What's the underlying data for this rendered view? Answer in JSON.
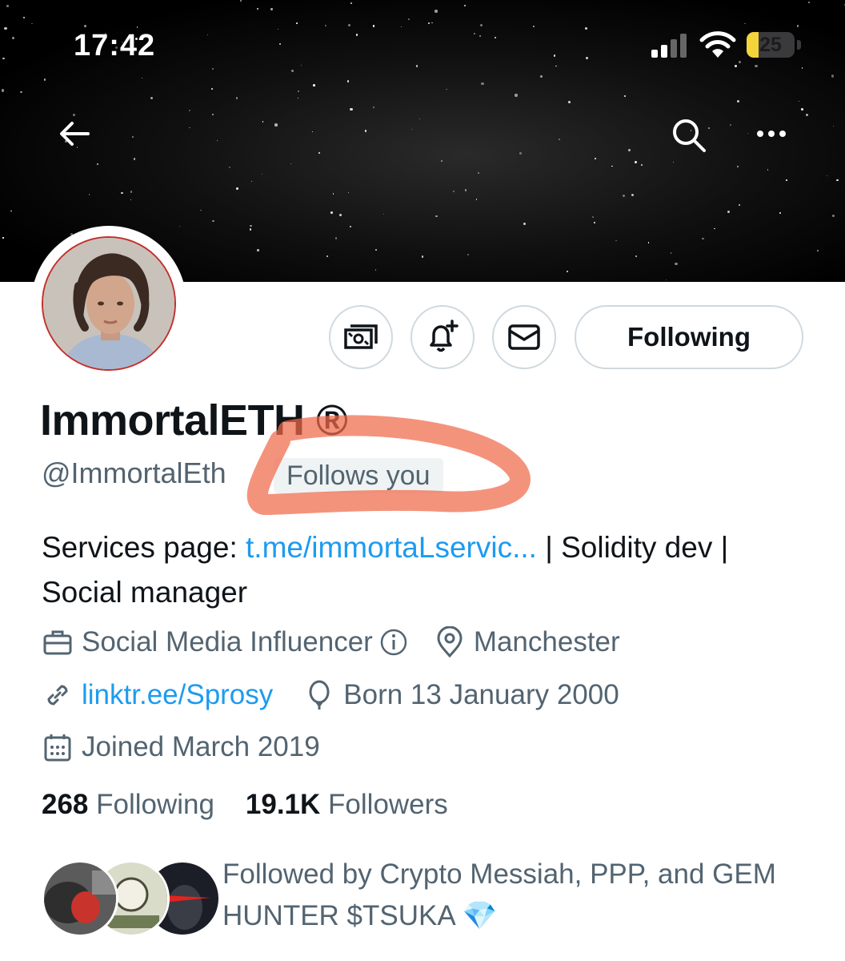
{
  "status_bar": {
    "time": "17:42",
    "battery": "25"
  },
  "profile": {
    "display_name": "ImmortalETH ®",
    "handle": "@ImmortalEth",
    "follows_you": "Follows you",
    "following_button": "Following",
    "bio": {
      "prefix": "Services page: ",
      "link": "t.me/immortaLservic...",
      "suffix": " | Solidity dev | Social manager"
    },
    "category": "Social Media Influencer",
    "location": "Manchester",
    "website": "linktr.ee/Sprosy",
    "birthday": "Born 13 January 2000",
    "joined": "Joined March 2019",
    "following_count": "268",
    "following_label": "Following",
    "followers_count": "19.1K",
    "followers_label": "Followers",
    "followed_by": "Followed by Crypto Messiah, PPP, and GEM HUNTER $TSUKA 💎"
  },
  "colors": {
    "accent": "#1d9bf0",
    "highlight": "#f06a4a",
    "secondary_text": "#536471"
  }
}
